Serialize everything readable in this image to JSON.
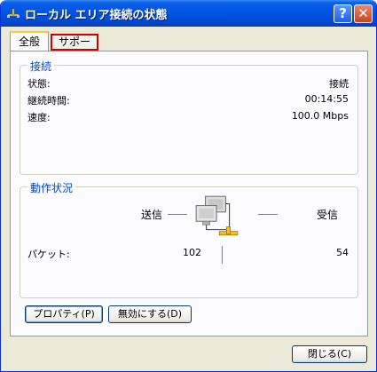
{
  "window": {
    "title": "ローカル エリア接続の状態",
    "help_label": "?",
    "close_glyph": "✕"
  },
  "tabs": [
    {
      "label": "全般"
    },
    {
      "label": "サポート"
    }
  ],
  "connection": {
    "group_title": "接続",
    "rows": [
      {
        "label": "状態:",
        "value": "接続"
      },
      {
        "label": "継続時間:",
        "value": "00:14:55"
      },
      {
        "label": "速度:",
        "value": "100.0 Mbps"
      }
    ]
  },
  "activity": {
    "group_title": "動作状況",
    "sent_label": "送信",
    "received_label": "受信",
    "packets_label": "パケット:",
    "sent_packets": "102",
    "received_packets": "54"
  },
  "buttons": {
    "properties": "プロパティ(P)",
    "disable": "無効にする(D)",
    "close": "閉じる(C)"
  }
}
